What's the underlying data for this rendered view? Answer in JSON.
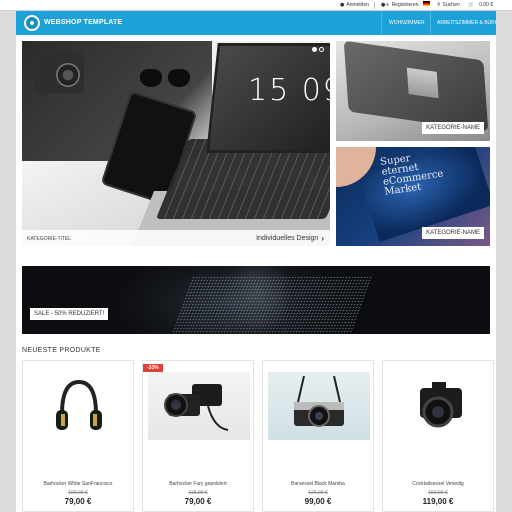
{
  "topbar": {
    "login": "Anmelden",
    "register": "Registrieren",
    "search": "Suchen",
    "cart_total": "0,00 €"
  },
  "navbar": {
    "logo_text": "WEBSHOP TEMPLATE",
    "links": [
      "WOHNZIMMER",
      "ARBEITSZIMMER & BÜRO"
    ]
  },
  "hero": {
    "clock": "15 09 5",
    "category": "KATEGORIE-TITEL",
    "design_link": "Individuelles Design"
  },
  "categories": [
    {
      "label": "KATEGORIE-NAME"
    },
    {
      "label": "KATEGORIE-NAME",
      "screen_text": "Super\neternet\neCommerce\nMarket"
    }
  ],
  "banner": {
    "label": "SALE - 50% REDUZIERT!"
  },
  "section": {
    "title": "NEUESTE PRODUKTE"
  },
  "products": [
    {
      "name": "Barhocker White SanFrancisco",
      "old_price": "109,00 €",
      "price": "79,00 €",
      "badge": ""
    },
    {
      "name": "Barhocker Fury gepolstert",
      "old_price": "118,00 €",
      "price": "79,00 €",
      "badge": "-33%"
    },
    {
      "name": "Barsessel Black Mamba",
      "old_price": "126,00 €",
      "price": "99,00 €",
      "badge": ""
    },
    {
      "name": "Cocktailsessel Venedig",
      "old_price": "150,00 €",
      "price": "119,00 €",
      "badge": ""
    }
  ],
  "colors": {
    "brand": "#1da1d8",
    "sale_badge": "#d9443c"
  }
}
